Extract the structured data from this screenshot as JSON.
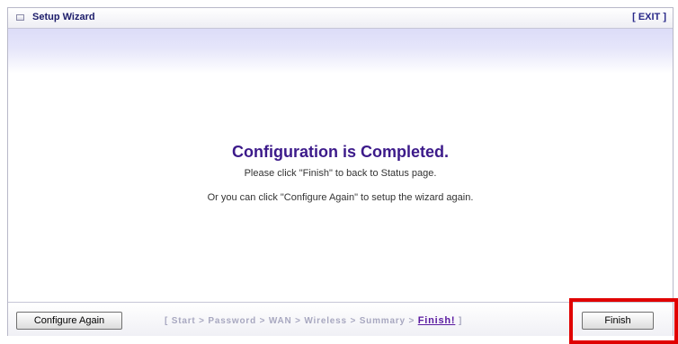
{
  "header": {
    "title": "Setup Wizard",
    "exit_label": "[ EXIT ]",
    "icon": "window-icon"
  },
  "main": {
    "headline": "Configuration is Completed.",
    "line1": "Please click \"Finish\" to back to Status page.",
    "line2": "Or you can click \"Configure Again\" to setup the wizard again."
  },
  "footer": {
    "configure_again_label": "Configure Again",
    "finish_label": "Finish",
    "steps": {
      "open_bracket": "[",
      "items": [
        "Start",
        "Password",
        "WAN",
        "Wireless",
        "Summary"
      ],
      "separator": ">",
      "current": "Finish!",
      "close_bracket": "]"
    }
  },
  "colors": {
    "accent_headline": "#3c1a8a",
    "step_active": "#5a1aa0",
    "step_inactive": "#a8a8c0",
    "highlight_box": "#e00000"
  }
}
